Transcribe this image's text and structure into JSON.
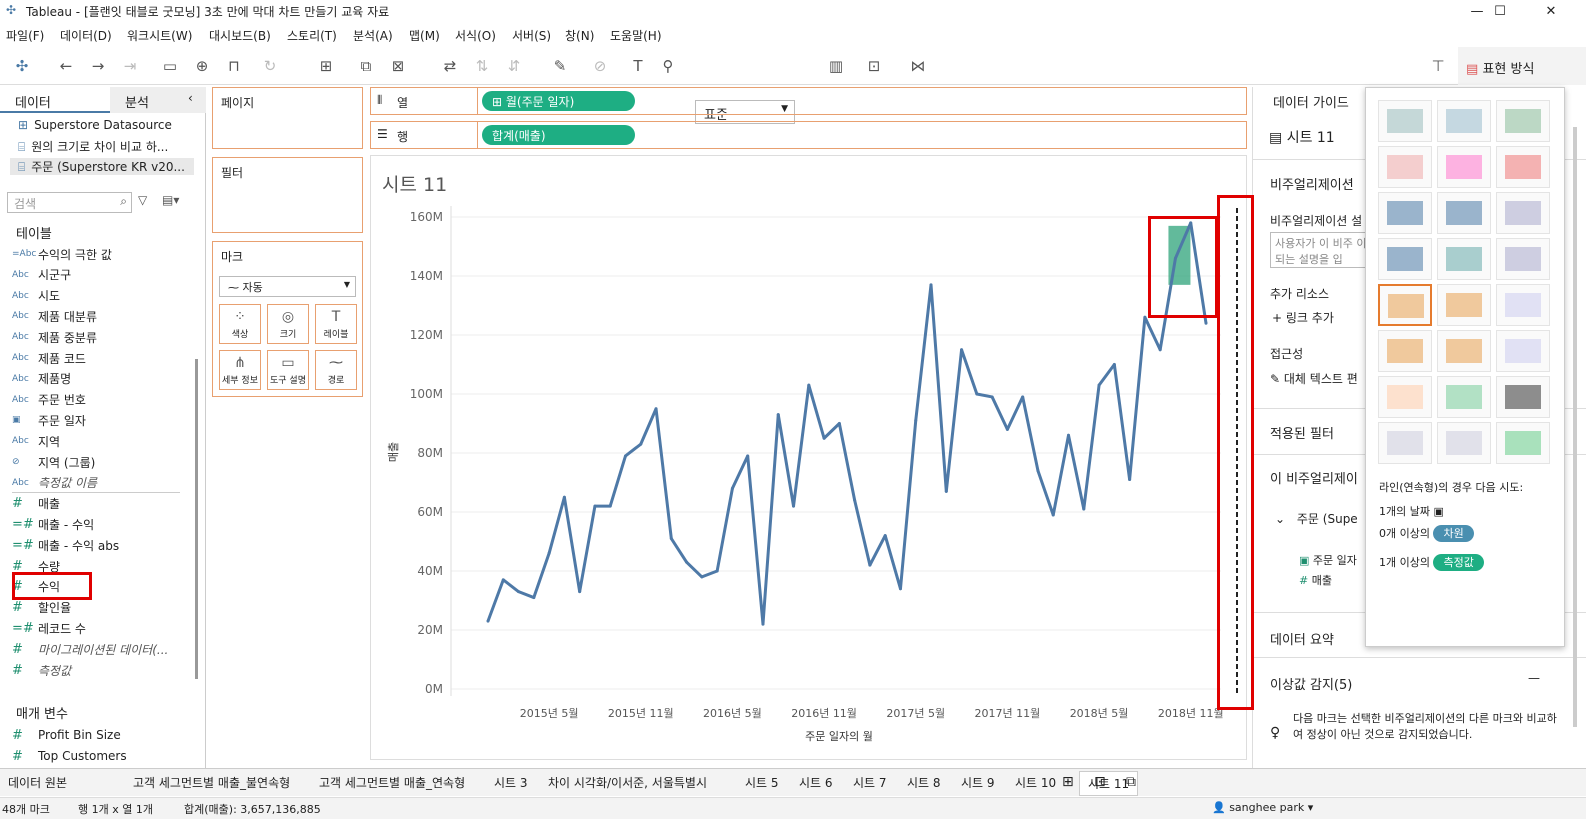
{
  "window": {
    "title": "Tableau - [플랜잇 태블로 굿모닝] 3초 만에 막대 차트 만들기 교육 자료"
  },
  "menu": [
    "파일(F)",
    "데이터(D)",
    "워크시트(W)",
    "대시보드(B)",
    "스토리(T)",
    "분석(A)",
    "맵(M)",
    "서식(O)",
    "서버(S)",
    "창(N)",
    "도움말(H)"
  ],
  "toolbar": {
    "fit": "표준",
    "showme": "표현 방식"
  },
  "left": {
    "tab_data": "데이터",
    "tab_analysis": "분석",
    "sources": [
      "Superstore Datasource",
      "원의 크기로 차이 비교 하...",
      "주문 (Superstore KR v20..."
    ],
    "search_placeholder": "검색",
    "tables_header": "테이블",
    "fields": [
      {
        "icon": "=Abc",
        "name": "수익의 극한 값"
      },
      {
        "icon": "Abc",
        "name": "시군구"
      },
      {
        "icon": "Abc",
        "name": "시도"
      },
      {
        "icon": "Abc",
        "name": "제품 대분류"
      },
      {
        "icon": "Abc",
        "name": "제품 중분류"
      },
      {
        "icon": "Abc",
        "name": "제품 코드"
      },
      {
        "icon": "Abc",
        "name": "제품명"
      },
      {
        "icon": "Abc",
        "name": "주문 번호"
      },
      {
        "icon": "▣",
        "name": "주문 일자"
      },
      {
        "icon": "Abc",
        "name": "지역"
      },
      {
        "icon": "⊘",
        "name": "지역 (그룹)"
      },
      {
        "icon": "Abc",
        "name": "측정값 이름"
      },
      {
        "icon": "#",
        "name": "매출"
      },
      {
        "icon": "=#",
        "name": "매출 - 수익"
      },
      {
        "icon": "=#",
        "name": "매출 - 수익 abs"
      },
      {
        "icon": "#",
        "name": "수량"
      },
      {
        "icon": "#",
        "name": "수익"
      },
      {
        "icon": "#",
        "name": "할인율"
      },
      {
        "icon": "=#",
        "name": "레코드 수"
      },
      {
        "icon": "#",
        "name": "마이그레이션된 데이터(..."
      },
      {
        "icon": "#",
        "name": "측정값"
      }
    ],
    "params_header": "매개 변수",
    "params": [
      {
        "icon": "#",
        "name": "Profit Bin Size"
      },
      {
        "icon": "#",
        "name": "Top Customers"
      }
    ]
  },
  "shelves": {
    "pages": "페이지",
    "filters": "필터",
    "marks": "마크",
    "mark_type": "자동",
    "mark_buttons": [
      "색상",
      "크기",
      "레이블",
      "세부 정보",
      "도구 설명",
      "경로"
    ],
    "columns_label": "열",
    "rows_label": "행",
    "columns_pill": "월(주문 일자)",
    "rows_pill": "합계(매출)"
  },
  "viz": {
    "sheet_title": "시트 11",
    "xlabel": "주문 일자의 월",
    "ylabel": "매출"
  },
  "chart_data": {
    "type": "line",
    "title": "시트 11",
    "xlabel": "주문 일자의 월",
    "ylabel": "매출",
    "ylim": [
      0,
      165000000
    ],
    "yticks": [
      "0M",
      "20M",
      "40M",
      "60M",
      "80M",
      "100M",
      "120M",
      "140M",
      "160M"
    ],
    "xticks": [
      "2015년 5월",
      "2015년 11월",
      "2016년 5월",
      "2016년 11월",
      "2017년 5월",
      "2017년 11월",
      "2018년 5월",
      "2018년 11월"
    ],
    "x": [
      "2015-01",
      "2015-02",
      "2015-03",
      "2015-04",
      "2015-05",
      "2015-06",
      "2015-07",
      "2015-08",
      "2015-09",
      "2015-10",
      "2015-11",
      "2015-12",
      "2016-01",
      "2016-02",
      "2016-03",
      "2016-04",
      "2016-05",
      "2016-06",
      "2016-07",
      "2016-08",
      "2016-09",
      "2016-10",
      "2016-11",
      "2016-12",
      "2017-01",
      "2017-02",
      "2017-03",
      "2017-04",
      "2017-05",
      "2017-06",
      "2017-07",
      "2017-08",
      "2017-09",
      "2017-10",
      "2017-11",
      "2017-12",
      "2018-01",
      "2018-02",
      "2018-03",
      "2018-04",
      "2018-05",
      "2018-06",
      "2018-07",
      "2018-08",
      "2018-09",
      "2018-10",
      "2018-11",
      "2018-12"
    ],
    "series": [
      {
        "name": "",
        "values": [
          23,
          37,
          33,
          31,
          46,
          65,
          33,
          62,
          62,
          79,
          83,
          95,
          51,
          43,
          38,
          40,
          68,
          79,
          22,
          93,
          62,
          103,
          85,
          90,
          64,
          42,
          52,
          34,
          91,
          137,
          67,
          115,
          100,
          99,
          88,
          99,
          74,
          59,
          86,
          61,
          103,
          110,
          71,
          126,
          115,
          146,
          158,
          124
        ]
      }
    ],
    "value_unit": "M",
    "line_color": "#4e79a7"
  },
  "guide": {
    "title": "데이터 가이드",
    "sheet": "시트 11",
    "viz_header": "비주얼리제이션",
    "viz_desc": "비주얼리제이션 설",
    "desc_placeholder": "사용자가 이 비주 이 되는 설명을 입",
    "resources": "추가 리소스",
    "add_link": "링크 추가",
    "access": "접근성",
    "alt_text": "대체 텍스트 편",
    "filters": "적용된 필터",
    "this_viz": "이 비주얼리제이",
    "orders": "주문 (Supe",
    "f1": "주문 일자",
    "f2": "매출",
    "summary": "데이터 요약",
    "outliers": "이상값 감지(5)",
    "outlier_desc": "다음 마크는 선택한 비주얼리제이션의 다른 마크와 비교하여 정상이 아닌 것으로 감지되었습니다."
  },
  "showme": {
    "hint": "라인(연속형)의 경우 다음 시도:",
    "r1": "1개의 날짜",
    "r2a": "0개 이상의",
    "r2b": "차원",
    "r3a": "1개 이상의",
    "r3b": "측정값"
  },
  "tabs": [
    "데이터 원본",
    "고객 세그먼트별 매출_불연속형",
    "고객 세그먼트별 매출_연속형",
    "시트 3",
    "차이 시각화/이서준, 서울특별시",
    "시트 5",
    "시트 6",
    "시트 7",
    "시트 8",
    "시트 9",
    "시트 10",
    "시트 11"
  ],
  "status": {
    "marks": "48개 마크",
    "rc": "행 1개 x 열 1개",
    "sum": "합계(매출): 3,657,136,885",
    "user": "sanghee park"
  }
}
